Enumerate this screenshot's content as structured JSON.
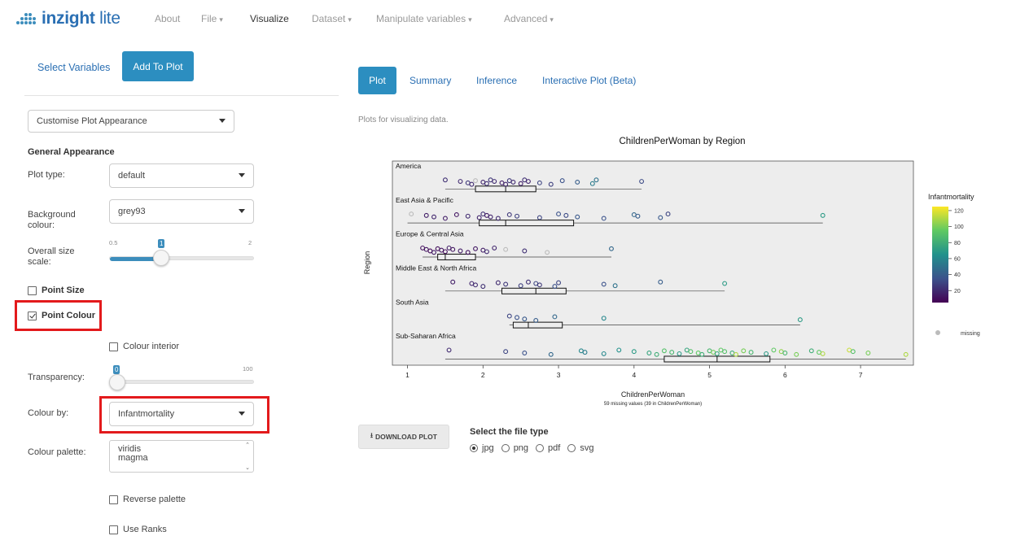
{
  "navbar": {
    "logo_brand": "inzight",
    "logo_suffix": " lite",
    "items": [
      {
        "label": "About",
        "caret": false
      },
      {
        "label": "File",
        "caret": true
      },
      {
        "label": "Visualize",
        "caret": false
      },
      {
        "label": "Dataset",
        "caret": true
      },
      {
        "label": "Manipulate variables",
        "caret": true
      },
      {
        "label": "Advanced",
        "caret": true
      }
    ]
  },
  "left_panel": {
    "select_variables_tab": "Select Variables",
    "add_to_plot_tab": "Add To Plot",
    "customise_select": "Customise Plot Appearance",
    "general_heading": "General Appearance",
    "plot_type_label": "Plot type:",
    "plot_type_value": "default",
    "background_label": "Background colour:",
    "background_value": "grey93",
    "size_scale_label": "Overall size scale:",
    "size_scale": {
      "min": "0.5",
      "max": "2",
      "value": "1",
      "fraction": 0.33
    },
    "point_size_label": "Point Size",
    "point_size_checked": false,
    "point_colour_label": "Point Colour",
    "point_colour_checked": true,
    "colour_interior_label": "Colour interior",
    "transparency_label": "Transparency:",
    "transparency": {
      "min": "0",
      "max": "100",
      "value": "0",
      "fraction": 0.0
    },
    "colour_by_label": "Colour by:",
    "colour_by_value": "Infantmortality",
    "palette_label": "Colour palette:",
    "palette_options": [
      "viridis",
      "magma"
    ],
    "reverse_palette_label": "Reverse palette",
    "use_ranks_label": "Use Ranks"
  },
  "right_panel": {
    "tabs": [
      "Plot",
      "Summary",
      "Inference",
      "Interactive Plot (Beta)"
    ],
    "active_tab": "Plot",
    "subtitle": "Plots for visualizing data.",
    "download_button": "DOWNLOAD PLOT",
    "file_type_label": "Select the file type",
    "file_types": [
      "jpg",
      "png",
      "pdf",
      "svg"
    ],
    "selected_file_type": "jpg"
  },
  "colors": {
    "accent": "#2c8ec0",
    "highlight_box": "#e31a1c",
    "plot_background": "#ededed"
  },
  "chart_data": {
    "type": "scatter",
    "title": "ChildrenPerWoman by Region",
    "xlabel": "ChildrenPerWoman",
    "ylabel": "Region",
    "footnote": "59 missing values (39 in ChildrenPerWoman)",
    "xlim": [
      0.8,
      7.7
    ],
    "x_ticks": [
      1,
      2,
      3,
      4,
      5,
      6,
      7
    ],
    "legend_title": "Infantmortality",
    "legend_ticks": [
      120,
      100,
      80,
      60,
      40,
      20
    ],
    "legend_missing_label": "missing",
    "color_range": [
      5,
      125
    ],
    "groups": [
      {
        "name": "America",
        "box": {
          "min": 1.5,
          "q1": 1.9,
          "median": 2.3,
          "q3": 2.7,
          "max": 4.1
        },
        "points": [
          [
            1.5,
            22
          ],
          [
            1.7,
            20
          ],
          [
            1.8,
            25
          ],
          [
            1.85,
            20
          ],
          [
            1.9,
            null
          ],
          [
            2.0,
            18
          ],
          [
            2.05,
            22
          ],
          [
            2.1,
            24
          ],
          [
            2.15,
            20
          ],
          [
            2.25,
            15
          ],
          [
            2.3,
            18
          ],
          [
            2.35,
            25
          ],
          [
            2.4,
            20
          ],
          [
            2.5,
            16
          ],
          [
            2.55,
            22
          ],
          [
            2.6,
            18
          ],
          [
            2.75,
            30
          ],
          [
            2.9,
            28
          ],
          [
            3.05,
            35
          ],
          [
            3.25,
            40
          ],
          [
            3.45,
            55
          ],
          [
            3.5,
            50
          ],
          [
            4.1,
            32
          ]
        ]
      },
      {
        "name": "East Asia & Pacific",
        "box": {
          "min": 1.0,
          "q1": 1.95,
          "median": 2.3,
          "q3": 3.2,
          "max": 6.5
        },
        "points": [
          [
            1.05,
            null
          ],
          [
            1.25,
            15
          ],
          [
            1.35,
            18
          ],
          [
            1.5,
            15
          ],
          [
            1.65,
            12
          ],
          [
            1.8,
            20
          ],
          [
            1.95,
            18
          ],
          [
            2.0,
            22
          ],
          [
            2.05,
            14
          ],
          [
            2.1,
            18
          ],
          [
            2.2,
            20
          ],
          [
            2.35,
            25
          ],
          [
            2.45,
            28
          ],
          [
            2.75,
            30
          ],
          [
            3.0,
            35
          ],
          [
            3.1,
            32
          ],
          [
            3.25,
            38
          ],
          [
            3.6,
            35
          ],
          [
            4.0,
            45
          ],
          [
            4.05,
            40
          ],
          [
            4.35,
            38
          ],
          [
            4.45,
            30
          ],
          [
            6.5,
            70
          ]
        ]
      },
      {
        "name": "Europe & Central Asia",
        "box": {
          "min": 1.2,
          "q1": 1.4,
          "median": 1.5,
          "q3": 1.9,
          "max": 3.7
        },
        "points": [
          [
            1.2,
            10
          ],
          [
            1.25,
            12
          ],
          [
            1.3,
            8
          ],
          [
            1.35,
            14
          ],
          [
            1.4,
            10
          ],
          [
            1.45,
            12
          ],
          [
            1.5,
            9
          ],
          [
            1.55,
            15
          ],
          [
            1.6,
            12
          ],
          [
            1.7,
            14
          ],
          [
            1.8,
            11
          ],
          [
            1.9,
            13
          ],
          [
            2.0,
            15
          ],
          [
            2.05,
            20
          ],
          [
            2.15,
            18
          ],
          [
            2.3,
            null
          ],
          [
            2.55,
            22
          ],
          [
            2.85,
            null
          ],
          [
            3.7,
            45
          ]
        ]
      },
      {
        "name": "Middle East & North Africa",
        "box": {
          "min": 1.5,
          "q1": 2.25,
          "median": 2.7,
          "q3": 3.1,
          "max": 5.2
        },
        "points": [
          [
            1.6,
            15
          ],
          [
            1.85,
            18
          ],
          [
            1.9,
            20
          ],
          [
            2.0,
            22
          ],
          [
            2.2,
            20
          ],
          [
            2.3,
            25
          ],
          [
            2.5,
            28
          ],
          [
            2.6,
            22
          ],
          [
            2.7,
            30
          ],
          [
            2.75,
            25
          ],
          [
            2.95,
            35
          ],
          [
            3.0,
            30
          ],
          [
            3.6,
            35
          ],
          [
            3.75,
            50
          ],
          [
            4.35,
            40
          ],
          [
            5.2,
            70
          ]
        ]
      },
      {
        "name": "South Asia",
        "box": {
          "min": 2.35,
          "q1": 2.4,
          "median": 2.6,
          "q3": 3.05,
          "max": 6.2
        },
        "points": [
          [
            2.35,
            30
          ],
          [
            2.45,
            35
          ],
          [
            2.55,
            38
          ],
          [
            2.7,
            40
          ],
          [
            2.95,
            45
          ],
          [
            3.6,
            60
          ],
          [
            6.2,
            70
          ]
        ]
      },
      {
        "name": "Sub-Saharan Africa",
        "box": {
          "min": 1.5,
          "q1": 4.4,
          "median": 5.1,
          "q3": 5.8,
          "max": 7.6
        },
        "points": [
          [
            1.55,
            20
          ],
          [
            2.3,
            30
          ],
          [
            2.55,
            35
          ],
          [
            2.9,
            45
          ],
          [
            3.3,
            60
          ],
          [
            3.35,
            55
          ],
          [
            3.6,
            60
          ],
          [
            3.8,
            65
          ],
          [
            4.0,
            70
          ],
          [
            4.2,
            75
          ],
          [
            4.3,
            80
          ],
          [
            4.4,
            90
          ],
          [
            4.5,
            85
          ],
          [
            4.6,
            70
          ],
          [
            4.7,
            75
          ],
          [
            4.75,
            90
          ],
          [
            4.85,
            95
          ],
          [
            4.9,
            80
          ],
          [
            5.0,
            85
          ],
          [
            5.05,
            100
          ],
          [
            5.1,
            75
          ],
          [
            5.15,
            95
          ],
          [
            5.2,
            90
          ],
          [
            5.3,
            80
          ],
          [
            5.35,
            110
          ],
          [
            5.45,
            100
          ],
          [
            5.55,
            85
          ],
          [
            5.75,
            70
          ],
          [
            5.85,
            95
          ],
          [
            5.95,
            105
          ],
          [
            6.0,
            85
          ],
          [
            6.15,
            100
          ],
          [
            6.35,
            80
          ],
          [
            6.45,
            95
          ],
          [
            6.5,
            110
          ],
          [
            6.85,
            115
          ],
          [
            6.9,
            90
          ],
          [
            7.1,
            100
          ],
          [
            7.6,
            110
          ]
        ]
      }
    ]
  }
}
